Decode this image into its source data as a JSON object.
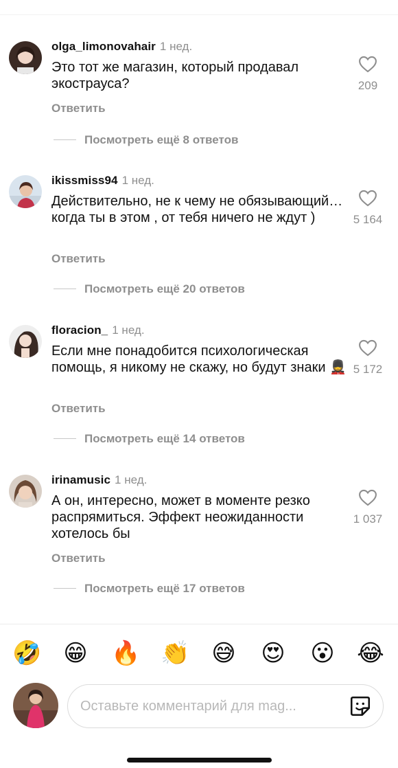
{
  "comments": [
    {
      "username": "olga_limonovahair",
      "time": "1 нед.",
      "text": "Это тот же магазин, который продавал экостраусa?",
      "likes": "209",
      "reply_label": "Ответить",
      "more_replies": "Посмотреть ещё 8 ответов"
    },
    {
      "username": "ikissmiss94",
      "time": "1 нед.",
      "text": "Действительно, не к чему не обязывающий… когда ты в этом , от тебя ничего не ждут )",
      "likes": "5 164",
      "reply_label": "Ответить",
      "more_replies": "Посмотреть ещё 20 ответов"
    },
    {
      "username": "floracion_",
      "time": "1 нед.",
      "text": "Если мне понадобится психологическая помощь, я никому не скажу, но будут знаки 💂",
      "likes": "5 172",
      "reply_label": "Ответить",
      "more_replies": "Посмотреть ещё 14 ответов"
    },
    {
      "username": "irinamusic",
      "time": "1 нед.",
      "text": "А он, интересно, может в моменте резко распрямиться. Эффект неожиданности хотелось бы",
      "likes": "1 037",
      "reply_label": "Ответить",
      "more_replies": "Посмотреть ещё 17 ответов"
    }
  ],
  "emoji_bar": [
    "🤣",
    "😁",
    "🔥",
    "👏",
    "😅",
    "😍",
    "😮",
    "😂"
  ],
  "composer": {
    "placeholder": "Оставьте комментарий для mag..."
  },
  "icons": {
    "like": "heart-outline-icon",
    "sticker": "sticker-icon"
  },
  "colors": {
    "muted_text": "#8e8e8e",
    "primary_text": "#111111",
    "divider": "#dbdbdb"
  }
}
